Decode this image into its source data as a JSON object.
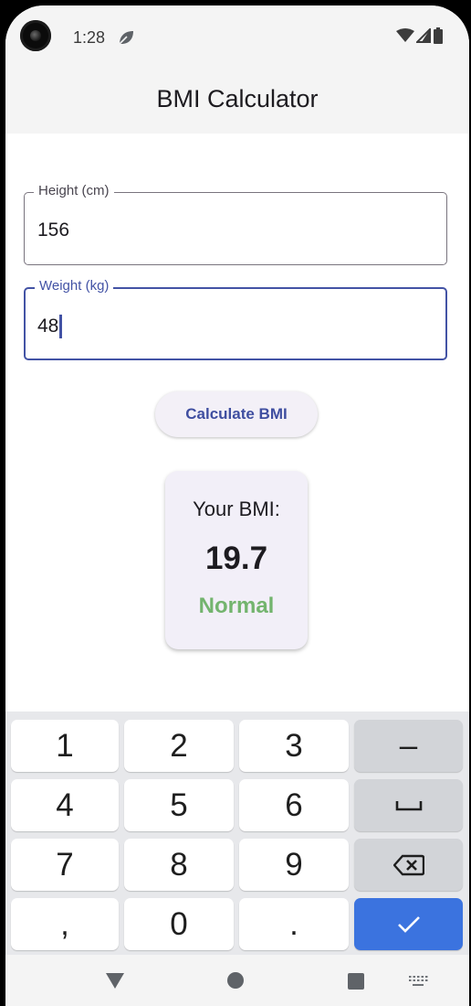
{
  "status_bar": {
    "time": "1:28"
  },
  "app_bar": {
    "title": "BMI Calculator"
  },
  "form": {
    "height": {
      "label": "Height (cm)",
      "value": "156"
    },
    "weight": {
      "label": "Weight (kg)",
      "value": "48"
    }
  },
  "calculate_button": {
    "label": "Calculate BMI"
  },
  "result": {
    "label": "Your BMI:",
    "value": "19.7",
    "category": "Normal",
    "category_color": "#73b46e"
  },
  "keyboard": {
    "keys": {
      "k1": "1",
      "k2": "2",
      "k3": "3",
      "minus": "–",
      "k4": "4",
      "k5": "5",
      "k6": "6",
      "k7": "7",
      "k8": "8",
      "k9": "9",
      "comma": ",",
      "k0": "0",
      "period": "."
    },
    "special_icons": [
      "space-icon",
      "backspace-icon",
      "checkmark-icon"
    ],
    "done_color": "#3b73df"
  },
  "nav_bar": {
    "icons": [
      "back-triangle-icon",
      "home-circle-icon",
      "recents-square-icon",
      "keyboard-switch-icon"
    ]
  },
  "colors": {
    "accent": "#4353a5",
    "button_text": "#3f4ea0"
  }
}
